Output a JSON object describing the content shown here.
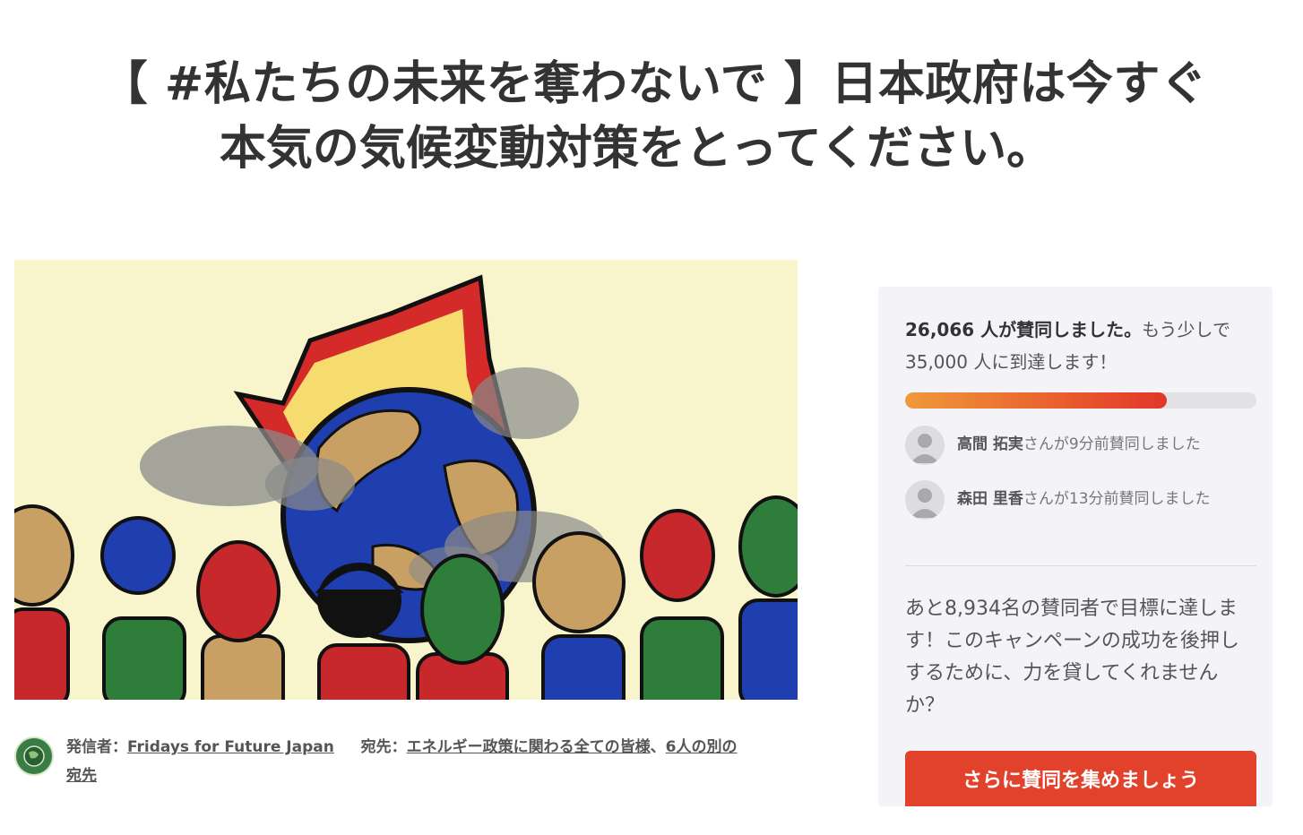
{
  "petition": {
    "title_line1": "【 #私たちの未来を奪わないで 】日本政府は今すぐ",
    "title_line2": "本気の気候変動対策をとってください。"
  },
  "meta": {
    "starter_label": "発信者：",
    "starter_name": "Fridays for Future Japan",
    "target_label": "宛先：",
    "target_name": "エネルギー政策に関わる全ての皆様",
    "target_sep": "、",
    "target_more_line1": "6人の別の",
    "target_more_line2": "宛先"
  },
  "signatures": {
    "count": "26,066",
    "count_suffix": " 人が賛同しました。",
    "goal_prefix": "もう少しで ",
    "goal": "35,000",
    "goal_suffix": " 人に到達します！",
    "progress_fraction": 0.745
  },
  "recent_signers": [
    {
      "name": "高間 拓実",
      "text": "さんが9分前賛同しました"
    },
    {
      "name": "森田 里香",
      "text": "さんが13分前賛同しました"
    }
  ],
  "pitch": "あと8,934名の賛同者で目標に達します！このキャンペーンの成功を後押しするために、力を貸してくれませんか？",
  "cta_label": "さらに賛同を集めましょう",
  "colors": {
    "accent": "#e2412b",
    "panel_bg": "#f4f3f7",
    "hero_bg": "#f8f4cc"
  },
  "icons": {
    "avatar": "user-silhouette-icon",
    "org": "fridays-for-future-logo"
  }
}
